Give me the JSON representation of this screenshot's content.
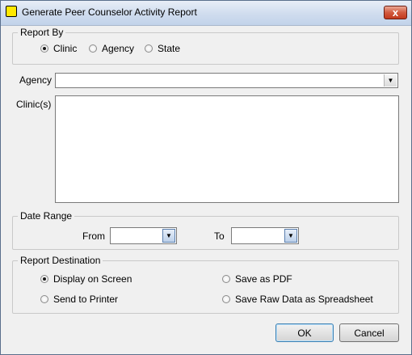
{
  "window": {
    "title": "Generate Peer Counselor Activity Report",
    "close_label": "x"
  },
  "report_by": {
    "legend": "Report By",
    "options": [
      {
        "label": "Clinic",
        "checked": true
      },
      {
        "label": "Agency",
        "checked": false
      },
      {
        "label": "State",
        "checked": false
      }
    ]
  },
  "agency": {
    "label": "Agency",
    "value": ""
  },
  "clinics": {
    "label": "Clinic(s)",
    "items": []
  },
  "date_range": {
    "legend": "Date Range",
    "from_label": "From",
    "from_value": "",
    "to_label": "To",
    "to_value": ""
  },
  "report_destination": {
    "legend": "Report Destination",
    "options": [
      {
        "label": "Display on Screen",
        "checked": true
      },
      {
        "label": "Send to Printer",
        "checked": false
      },
      {
        "label": "Save as PDF",
        "checked": false
      },
      {
        "label": "Save Raw Data as Spreadsheet",
        "checked": false
      }
    ]
  },
  "buttons": {
    "ok": "OK",
    "cancel": "Cancel"
  },
  "icons": {
    "dropdown": "chevron-down-icon",
    "app": "app-icon",
    "close": "close-icon"
  }
}
